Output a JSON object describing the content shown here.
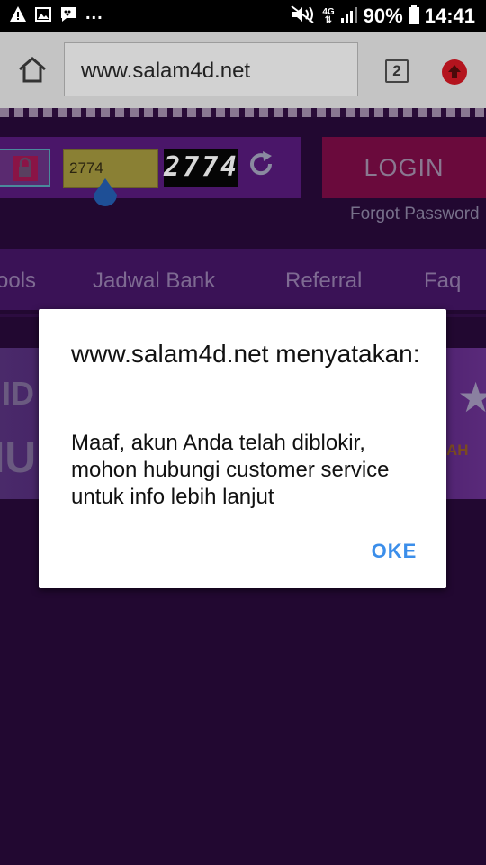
{
  "status_bar": {
    "overflow_dots": "...",
    "network_type": "4G",
    "battery_percent": "90%",
    "time": "14:41",
    "icons": [
      "warning-icon",
      "image-icon",
      "bbm-chat-icon",
      "mute-icon",
      "signal-icon",
      "battery-icon"
    ]
  },
  "browser": {
    "url": "www.salam4d.net",
    "tab_count": "2",
    "icons": [
      "home-icon",
      "tabs-icon",
      "upload-icon"
    ]
  },
  "page": {
    "captcha_input_value": "2774",
    "captcha_code": "2774",
    "login_label": "LOGIN",
    "forgot_password": "Forgot Password",
    "nav_items": [
      "ools",
      "Jadwal Bank",
      "Referral",
      "Faq"
    ],
    "banner": {
      "text1": "IID",
      "text2": "IU",
      "tag": "AH"
    }
  },
  "dialog": {
    "title": "www.salam4d.net menyatakan:",
    "message": "Maaf, akun Anda telah diblokir, mohon hubungi customer service untuk info lebih lanjut",
    "ok_label": "OKE"
  },
  "colors": {
    "dialog_button": "#3b8eea",
    "page_background": "#220831",
    "login_button": "#6a0a3c"
  }
}
